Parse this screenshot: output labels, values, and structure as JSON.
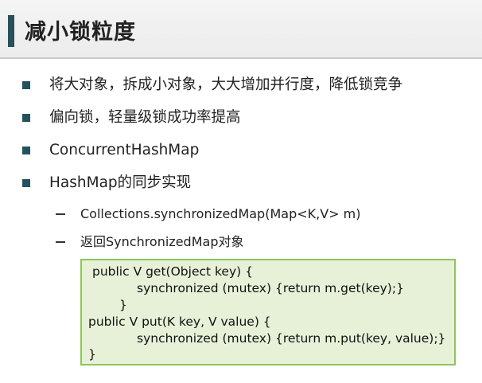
{
  "slide": {
    "title": "减小锁粒度",
    "bullets": [
      "将大对象，拆成小对象，大大增加并行度，降低锁竞争",
      "偏向锁，轻量级锁成功率提高",
      "ConcurrentHashMap",
      "HashMap的同步实现"
    ],
    "sub_bullets": [
      "Collections.synchronizedMap(Map<K,V>  m)",
      "返回SynchronizedMap对象"
    ],
    "code_lines": [
      "public V get(Object key) {",
      "synchronized (mutex) {return m.get(key);}",
      "}",
      "public V put(K key, V value) {",
      "synchronized (mutex) {return m.put(key, value);}",
      "}"
    ],
    "colors": {
      "accent": "#27505c",
      "bullet": "#24515e",
      "code_background": "#e6f1d8",
      "code_border": "#8cc65a"
    }
  }
}
